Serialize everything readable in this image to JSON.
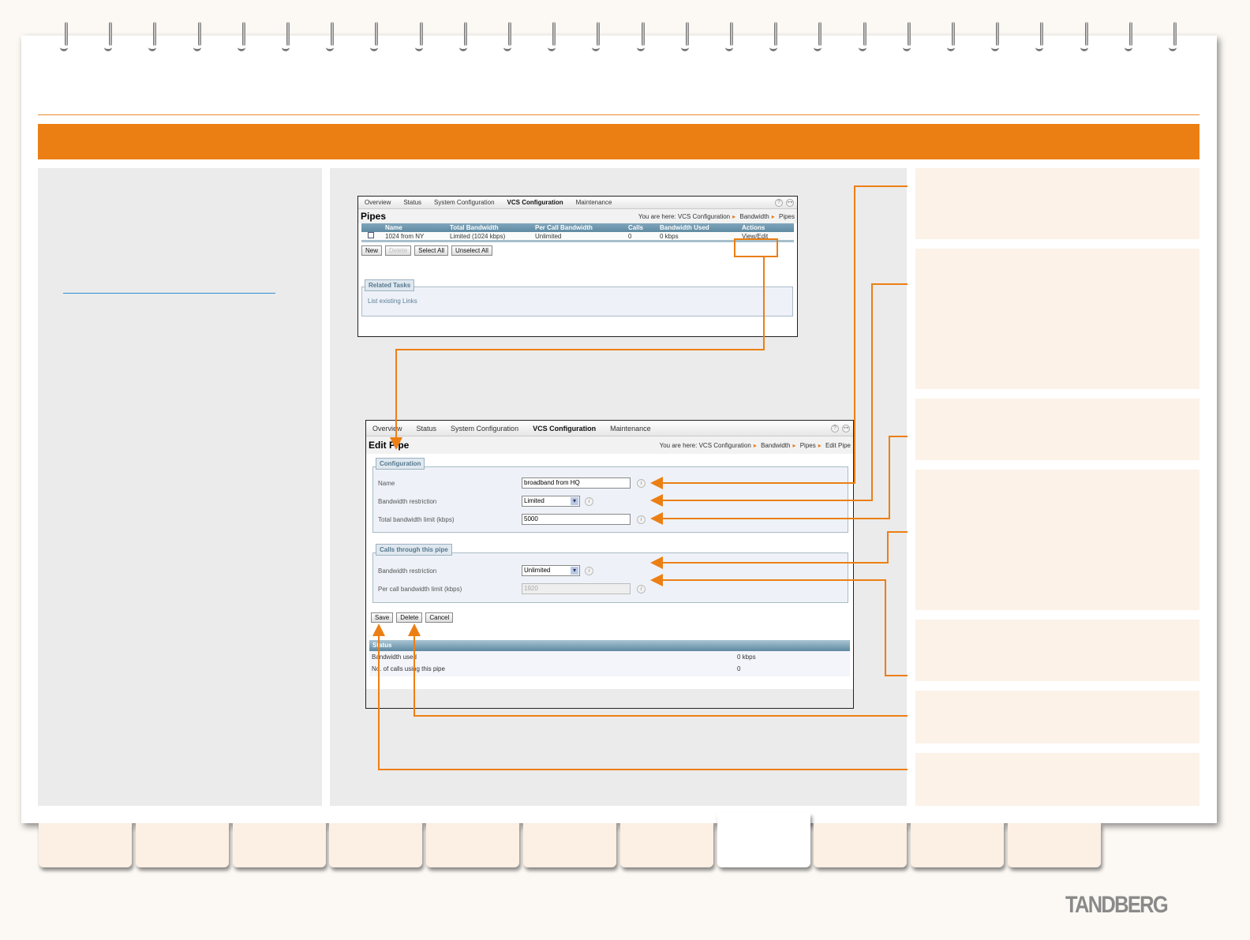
{
  "brand": "TANDBERG",
  "nav": [
    "Overview",
    "Status",
    "System Configuration",
    "VCS Configuration",
    "Maintenance"
  ],
  "pipes": {
    "title": "Pipes",
    "breadcrumb": {
      "prefix": "You are here:",
      "items": [
        "VCS Configuration",
        "Bandwidth",
        "Pipes"
      ]
    },
    "columns": [
      "Name",
      "Total Bandwidth",
      "Per Call Bandwidth",
      "Calls",
      "Bandwidth Used",
      "Actions"
    ],
    "rows": [
      {
        "name": "1024 from NY",
        "total": "Limited (1024 kbps)",
        "per_call": "Unlimited",
        "calls": "0",
        "used": "0 kbps",
        "action": "View/Edit"
      }
    ],
    "buttons": {
      "new": "New",
      "delete": "Delete",
      "select_all": "Select All",
      "unselect_all": "Unselect All"
    },
    "related_tasks": {
      "title": "Related Tasks",
      "link": "List existing Links"
    }
  },
  "edit": {
    "title": "Edit Pipe",
    "breadcrumb": {
      "prefix": "You are here:",
      "items": [
        "VCS Configuration",
        "Bandwidth",
        "Pipes",
        "Edit Pipe"
      ]
    },
    "configuration": {
      "legend": "Configuration",
      "name_label": "Name",
      "name_value": "broadband from HQ",
      "restriction_label": "Bandwidth restriction",
      "restriction_value": "Limited",
      "total_label": "Total bandwidth limit (kbps)",
      "total_value": "5000"
    },
    "calls": {
      "legend": "Calls through this pipe",
      "restriction_label": "Bandwidth restriction",
      "restriction_value": "Unlimited",
      "per_call_label": "Per call bandwidth limit (kbps)",
      "per_call_value": "1920"
    },
    "buttons": {
      "save": "Save",
      "delete": "Delete",
      "cancel": "Cancel"
    },
    "status": {
      "title": "Status",
      "rows": [
        {
          "label": "Bandwidth used",
          "value": "0 kbps"
        },
        {
          "label": "No. of calls using this pipe",
          "value": "0"
        }
      ]
    }
  },
  "icons": {
    "help": "?",
    "logout": "⊶",
    "info": "i"
  }
}
